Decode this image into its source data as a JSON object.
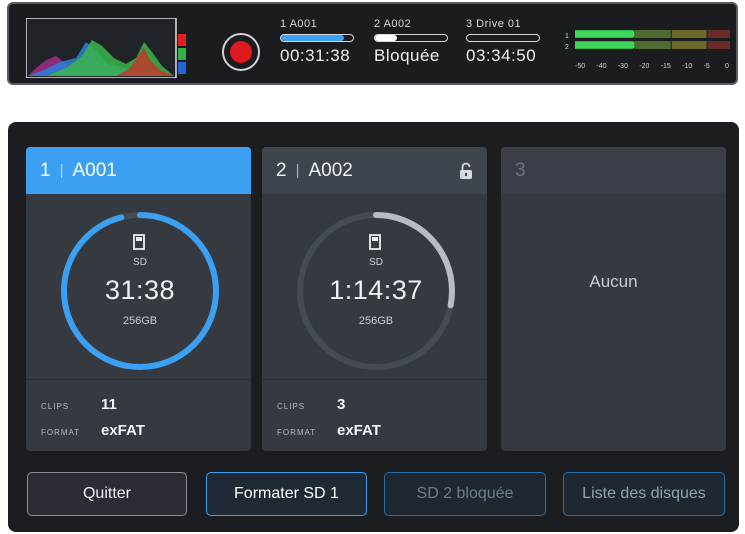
{
  "topbar": {
    "slots": [
      {
        "label": "1  A001",
        "value": "00:31:38",
        "fill": 0.88,
        "color": "#3ba0f2"
      },
      {
        "label": "2  A002",
        "value": "Bloquée",
        "fill": 0.3,
        "color": "#ffffff"
      },
      {
        "label": "3  Drive 01",
        "value": "03:34:50",
        "fill": 0.0,
        "color": "#ffffff"
      }
    ],
    "meter_scale": [
      "-50",
      "-40",
      "-30",
      "-20",
      "-15",
      "-10",
      "-5",
      "0"
    ],
    "meter_channels": [
      "1",
      "2"
    ],
    "meter_levels": [
      0.38,
      0.38
    ]
  },
  "cards": [
    {
      "slot": "1",
      "name": "A001",
      "media": "SD",
      "time": "31:38",
      "capacity": "256GB",
      "clips_label": "CLIPS",
      "clips": "11",
      "format_label": "FORMAT",
      "format": "exFAT",
      "ring_fraction": 0.96,
      "ring_color": "#3ba0f2"
    },
    {
      "slot": "2",
      "name": "A002",
      "media": "SD",
      "time": "1:14:37",
      "capacity": "256GB",
      "clips_label": "CLIPS",
      "clips": "3",
      "format_label": "FORMAT",
      "format": "exFAT",
      "ring_fraction": 0.28,
      "ring_color": "#b8bcc1"
    },
    {
      "slot": "3",
      "empty_text": "Aucun"
    }
  ],
  "buttons": {
    "quit": "Quitter",
    "format": "Formater SD 1",
    "locked": "SD 2 bloquée",
    "drives": "Liste des disques"
  },
  "colors": {
    "accent": "#3ba0f2",
    "record": "#e0191f",
    "panel": "#1b1d20",
    "card": "#353a41"
  }
}
